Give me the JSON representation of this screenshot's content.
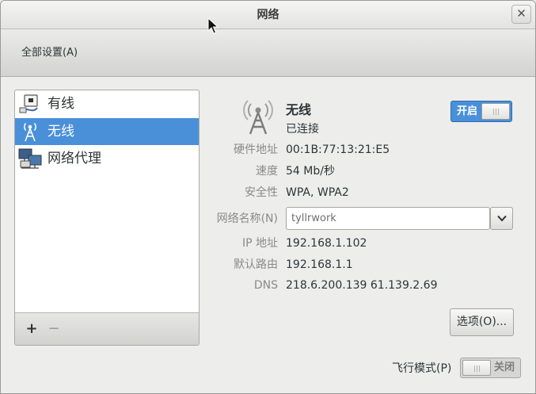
{
  "window": {
    "title": "网络",
    "close_glyph": "✕"
  },
  "toolbar": {
    "all_settings_label": "全部设置(A)"
  },
  "sidebar": {
    "items": [
      {
        "label": "有线",
        "icon": "wired-network-icon"
      },
      {
        "label": "无线",
        "icon": "wireless-network-icon",
        "selected": true
      },
      {
        "label": "网络代理",
        "icon": "network-proxy-icon"
      }
    ],
    "add_label": "+",
    "remove_label": "−"
  },
  "detail": {
    "name": "无线",
    "status": "已连接",
    "power_switch": {
      "label": "开启",
      "state": "on"
    },
    "fields": {
      "hardware_address_label": "硬件地址",
      "hardware_address_value": "00:1B:77:13:21:E5",
      "speed_label": "速度",
      "speed_value": "54 Mb/秒",
      "security_label": "安全性",
      "security_value": "WPA, WPA2",
      "ssid_label": "网络名称(N)",
      "ssid_value": "tyllrwork",
      "ip_label": "IP 地址",
      "ip_value": "192.168.1.102",
      "gateway_label": "默认路由",
      "gateway_value": "192.168.1.1",
      "dns_label": "DNS",
      "dns_value": "218.6.200.139 61.139.2.69"
    },
    "options_label": "选项(O)...",
    "airplane_mode": {
      "label": "飞行模式(P)",
      "switch_label": "关闭",
      "state": "off"
    }
  },
  "colors": {
    "accent": "#4a90d9",
    "window_bg": "#ededec"
  }
}
